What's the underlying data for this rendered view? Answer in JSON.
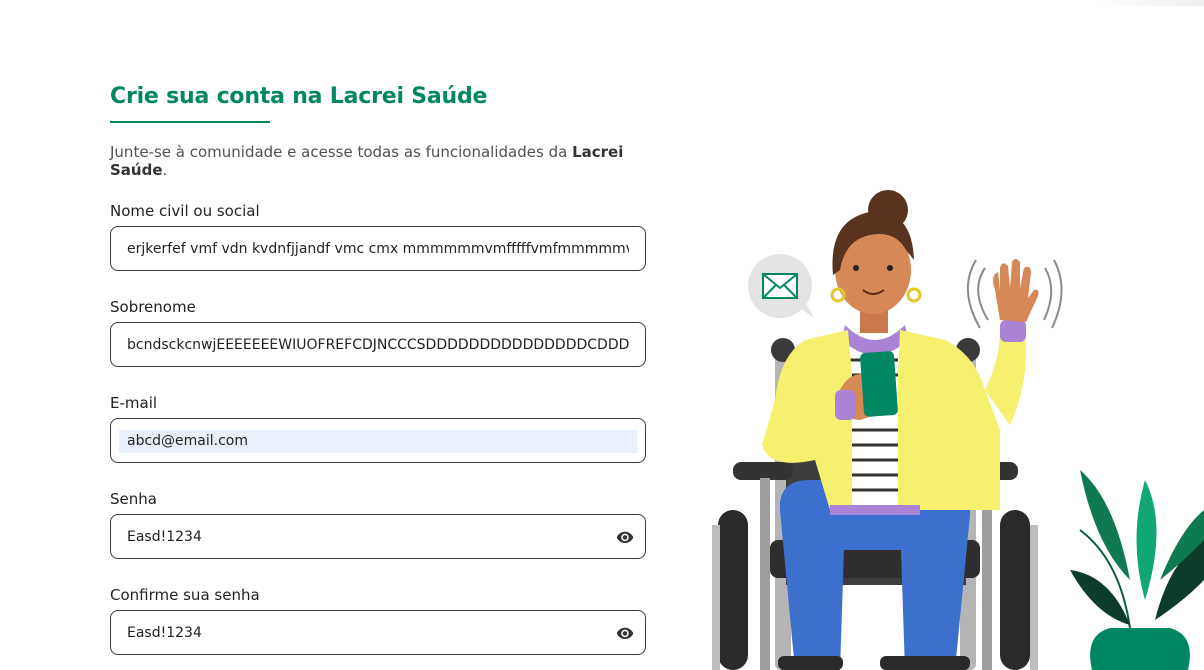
{
  "page": {
    "title": "Crie sua conta na Lacrei Saúde",
    "subtitle_prefix": "Junte-se à comunidade e acesse todas as funcionalidades da ",
    "subtitle_brand": "Lacrei Saúde",
    "subtitle_suffix": "."
  },
  "form": {
    "name": {
      "label": "Nome civil ou social",
      "value": "erjkerfef vmf vdn kvdnfjjandf vmc    cmx mmmmmmvmfffffvmfmmmmmvmfm"
    },
    "surname": {
      "label": "Sobrenome",
      "value": "bcndsckcnwjEEEEEEEWIUOFREFCDJNCCCSDDDDDDDDDDDDDDDCDDDD"
    },
    "email": {
      "label": "E-mail",
      "value": "abcd@email.com"
    },
    "password": {
      "label": "Senha",
      "value": "Easd!1234",
      "icon": "eye-icon"
    },
    "confirm_password": {
      "label": "Confirme sua senha",
      "value": "Easd!1234",
      "icon": "eye-icon"
    }
  },
  "colors": {
    "brand": "#018762",
    "border": "#3c3c3c",
    "autofill": "#e8f0fe"
  }
}
